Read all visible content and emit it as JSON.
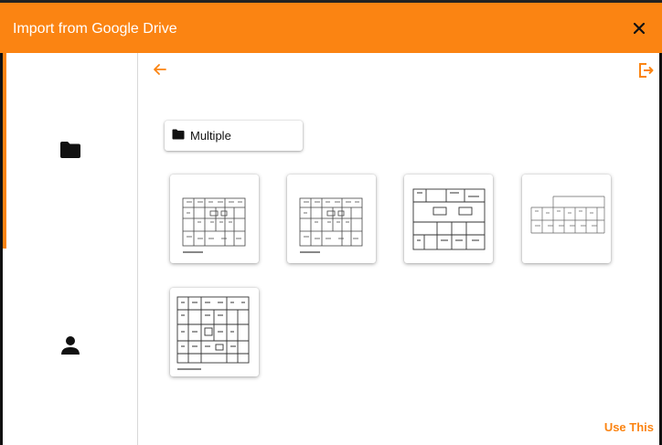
{
  "dialog": {
    "title": "Import from Google Drive",
    "accent_color": "#fb8412"
  },
  "header": {
    "close_icon": "close-icon"
  },
  "sidebar": {
    "items": [
      {
        "icon": "folder-icon",
        "active": true
      },
      {
        "icon": "person-icon",
        "active": false
      }
    ]
  },
  "toolbar": {
    "back_icon": "arrow-left-icon",
    "logout_icon": "logout-icon"
  },
  "folders": [
    {
      "label": "Multiple",
      "icon": "folder-icon"
    }
  ],
  "files": [
    {
      "kind": "floor-plan-thumbnail"
    },
    {
      "kind": "floor-plan-thumbnail"
    },
    {
      "kind": "floor-plan-thumbnail"
    },
    {
      "kind": "floor-plan-thumbnail"
    },
    {
      "kind": "floor-plan-thumbnail"
    }
  ],
  "footer": {
    "use_this_label": "Use This"
  }
}
